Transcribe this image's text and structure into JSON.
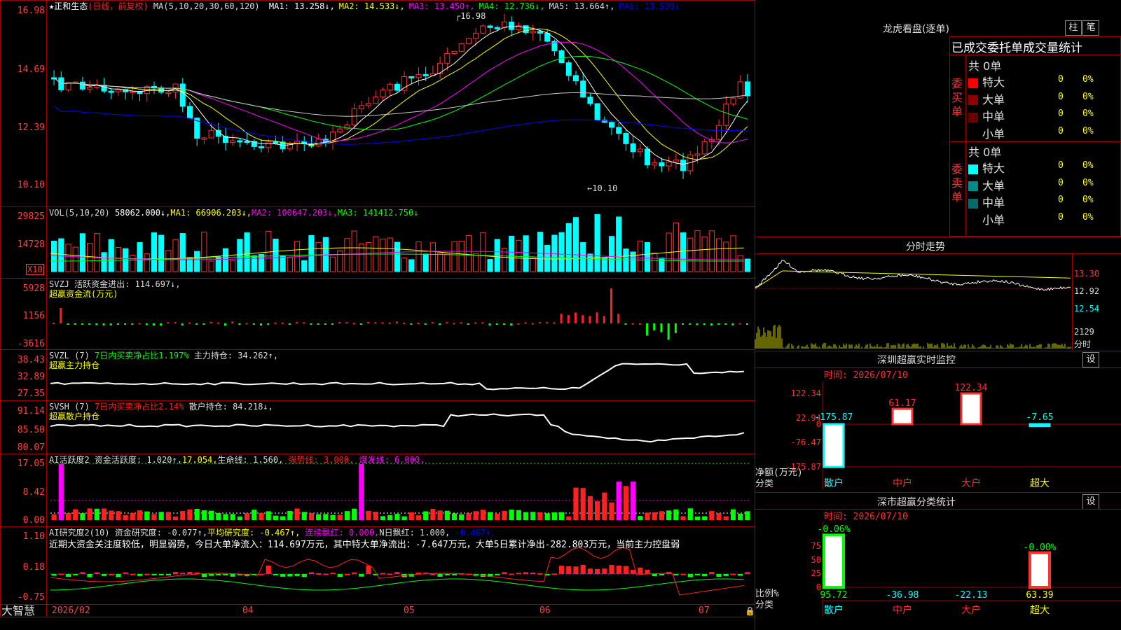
{
  "main": {
    "title": "★正和生态",
    "mode": "(日线，前复权)",
    "ma_text": "MA(5,10,20,30,60,120)",
    "ma": [
      {
        "l": "MA1: 13.258↓",
        "c": "#ffffff"
      },
      {
        "l": "MA2: 14.533↓",
        "c": "#ffff00"
      },
      {
        "l": "MA3: 13.450↑",
        "c": "#ff00ff"
      },
      {
        "l": "MA4: 12.736↓",
        "c": "#00ff00"
      },
      {
        "l": "MA5: 13.664↑",
        "c": "#dddddd"
      },
      {
        "l": "MA6: 13.539↓",
        "c": "#0000ff"
      }
    ],
    "y": [
      "16.98",
      "14.69",
      "12.39",
      "10.10"
    ],
    "hi": "16.98",
    "lo": "10.10"
  },
  "vol": {
    "title": "VOL(5,10,20)",
    "val": "58062.000↓,",
    "ma1": "MA1: 66906.203↓,",
    "ma2": "MA2: 100647.203↓,",
    "ma3": "MA3: 141412.750↓",
    "y": [
      "29825",
      "14728"
    ],
    "unit": "X10"
  },
  "svzj": {
    "t1": "SVZJ  活跃资金进出: 114.697↓,",
    "t2": "超赢资金流(万元)",
    "y": [
      "5928",
      "1156",
      "-3616"
    ]
  },
  "svzl": {
    "t1": "SVZL (7)",
    "t2": "7日内买卖净占比1.197%",
    "t3": "主力持仓: 34.262↑,",
    "t4": "超赢主力持仓",
    "y": [
      "38.43",
      "32.89",
      "27.35"
    ]
  },
  "svsh": {
    "t1": "SVSH (7)",
    "t2": "7日内买卖净占比2.14%",
    "t3": "散户持仓: 84.218↓,",
    "t4": "超赢散户持仓",
    "y": [
      "91.14",
      "85.50",
      "80.07"
    ]
  },
  "ai1": {
    "t1": "AI活跃度2 资金活跃度: 1.020↑,",
    "t2": "17.054,",
    "t3": "生命线: 1.560,",
    "t4": "强势线: 3.000,",
    "t5": "爆发线: 6.000,",
    "y": [
      "17.05",
      "8.42",
      "0.00"
    ]
  },
  "ai2": {
    "t1": "AI研究度2(10) 资金研究度: -0.077↑,",
    "t2": "平均研究度: -0.467↑,",
    "t3": "连续飘红: 0.000,",
    "t4": "N日飘红: 1.000,",
    "t5": "-0.467↑,",
    "t6": "近期大资金关注度较低，明显弱势，今日大单净流入：114.697万元，其中特大单净流出：-7.647万元，大单5日累计净出-282.803万元，当前主力控盘弱",
    "y": [
      "1.10",
      "0.18",
      "-0.75"
    ]
  },
  "xaxis": [
    "2026/02",
    "04",
    "05",
    "06",
    "07"
  ],
  "brand": "大智慧",
  "lhb": {
    "title": "龙虎看盘(逐单)",
    "b1": "柱",
    "b2": "笔",
    "sub": "已成交委托单成交量统计",
    "buy": {
      "side": "委买单",
      "total": "共 0单",
      "rows": [
        {
          "n": "特大",
          "v": "0",
          "p": "0%",
          "c": "#ff0000"
        },
        {
          "n": "大单",
          "v": "0",
          "p": "0%",
          "c": "#8b0000"
        },
        {
          "n": "中单",
          "v": "0",
          "p": "0%",
          "c": "#6b0000"
        },
        {
          "n": "小单",
          "v": "0",
          "p": "0%",
          "c": "#000000"
        }
      ]
    },
    "sell": {
      "side": "委卖单",
      "total": "共 0单",
      "rows": [
        {
          "n": "特大",
          "v": "0",
          "p": "0%",
          "c": "#00ffff"
        },
        {
          "n": "大单",
          "v": "0",
          "p": "0%",
          "c": "#008b8b"
        },
        {
          "n": "中单",
          "v": "0",
          "p": "0%",
          "c": "#006b6b"
        },
        {
          "n": "小单",
          "v": "0",
          "p": "0%",
          "c": "#000000"
        }
      ]
    }
  },
  "fenshi": {
    "title": "分时走势",
    "y": [
      "13.30",
      "12.92",
      "12.54"
    ],
    "vol": "2129",
    "vol_unit": "分时"
  },
  "szmon": {
    "title": "深圳超赢实时监控",
    "btn": "设",
    "time": "时间: 2026/07/10",
    "y": [
      "122.34",
      "22.94",
      "0",
      "-76.47",
      "-175.87"
    ],
    "ylabel1": "净额(万元)",
    "ylabel2": "分类",
    "cats": [
      "散户",
      "中户",
      "大户",
      "超大"
    ],
    "vals": [
      "-175.87",
      "61.17",
      "122.34",
      "-7.65"
    ]
  },
  "szcls": {
    "title": "深市超赢分类统计",
    "btn": "设",
    "time": "时间: 2026/07/10",
    "y": [
      "75",
      "50",
      "25",
      "0"
    ],
    "ylabel1": "比例%",
    "ylabel2": "分类",
    "cats": [
      "散户",
      "中户",
      "大户",
      "超大"
    ],
    "vals": [
      "95.72",
      "-36.98",
      "-22.13",
      "63.39"
    ],
    "top1": "-0.06%",
    "top4": "-0.00%"
  }
}
